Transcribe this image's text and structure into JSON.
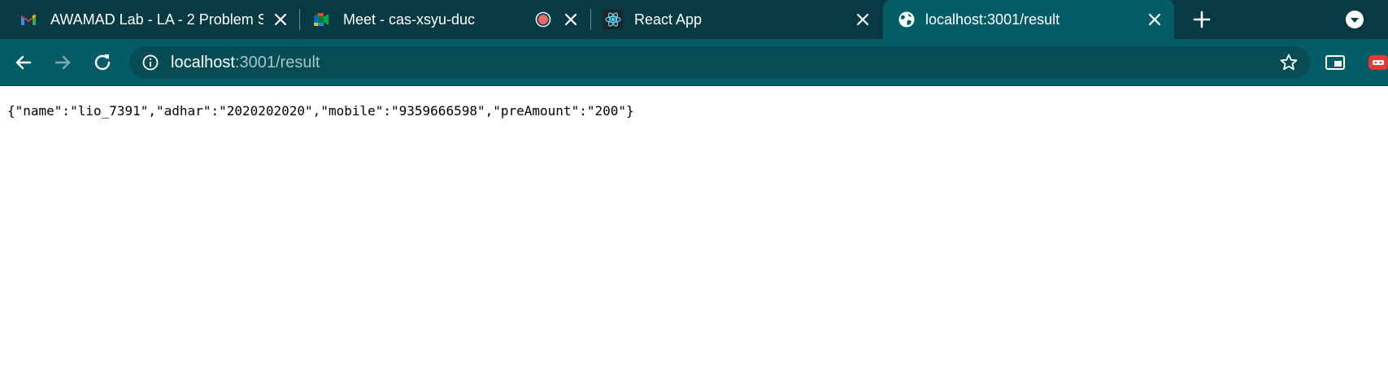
{
  "tabs": [
    {
      "title": "AWAMAD Lab - LA - 2 Problem S",
      "icon": "gmail-icon",
      "active": false
    },
    {
      "title": "Meet - cas-xsyu-duc",
      "icon": "google-meet-icon",
      "recording": true,
      "active": false
    },
    {
      "title": "React App",
      "icon": "react-icon",
      "active": false
    },
    {
      "title": "localhost:3001/result",
      "icon": "globe-icon",
      "active": true
    }
  ],
  "omnibox": {
    "host": "localhost",
    "rest": ":3001/result"
  },
  "page": {
    "content": "{\"name\":\"lio_7391\",\"adhar\":\"2020202020\",\"mobile\":\"9359666598\",\"preAmount\":\"200\"}"
  },
  "colors": {
    "tabstrip": "#073a43",
    "toolbar": "#045c66",
    "omnibox": "#074b54"
  }
}
